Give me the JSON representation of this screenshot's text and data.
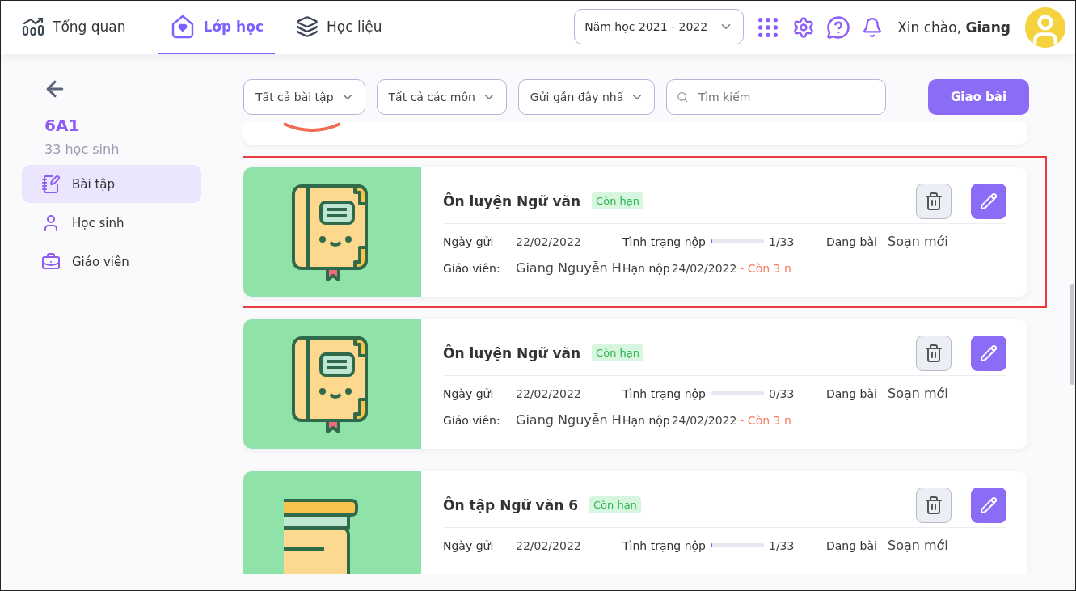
{
  "nav": {
    "items": [
      {
        "label": "Tổng quan",
        "selected": false
      },
      {
        "label": "Lớp học",
        "selected": true
      },
      {
        "label": "Học liệu",
        "selected": false
      }
    ],
    "year_select": "Năm học 2021 - 2022",
    "greeting": "Xin chào, **Giang**"
  },
  "sidebar": {
    "class_name": "6A1",
    "student_count": "33 học sinh",
    "items": [
      {
        "label": "Bài tập",
        "selected": true
      },
      {
        "label": "Học sinh",
        "selected": false
      },
      {
        "label": "Giáo viên",
        "selected": false
      }
    ]
  },
  "filters": [
    "Tất cả bài tập",
    "Tất cả các môn",
    "Gửi gần đây nhấ"
  ],
  "search": {
    "placeholder": "Tìm kiếm"
  },
  "assign_button": "Giao bài",
  "assignments": [
    {
      "title": "Ôn luyện Ngữ văn",
      "badge": "Còn hạn",
      "highlighted": true,
      "sent_label": "Ngày gửi",
      "sent_date": "22/02/2022",
      "status_label": "Tình trạng nộp",
      "level": 0.03,
      "count": "1/33",
      "type_label": "Dạng bài",
      "type_value": "Soạn mới",
      "teacher_label": "Giáo viên:",
      "teacher": "Giang Nguyễn H",
      "due_label": "Hạn nộp",
      "due_date": "24/02/2022",
      "due_note": "- Còn 3 n"
    },
    {
      "title": "Ôn luyện Ngữ văn",
      "badge": "Còn hạn",
      "highlighted": false,
      "sent_label": "Ngày gửi",
      "sent_date": "22/02/2022",
      "status_label": "Tình trạng nộp",
      "level": 0,
      "count": "0/33",
      "type_label": "Dạng bài",
      "type_value": "Soạn mới",
      "teacher_label": "Giáo viên:",
      "teacher": "Giang Nguyễn H",
      "due_label": "Hạn nộp",
      "due_date": "24/02/2022",
      "due_note": "- Còn 3 n"
    },
    {
      "title": "Ôn tập Ngữ văn 6",
      "badge": "Còn hạn",
      "highlighted": false,
      "sent_label": "Ngày gửi",
      "sent_date": "22/02/2022",
      "status_label": "Tình trạng nộp",
      "level": 0.03,
      "count": "1/33",
      "type_label": "Dạng bài",
      "type_value": "Soạn mới"
    }
  ]
}
